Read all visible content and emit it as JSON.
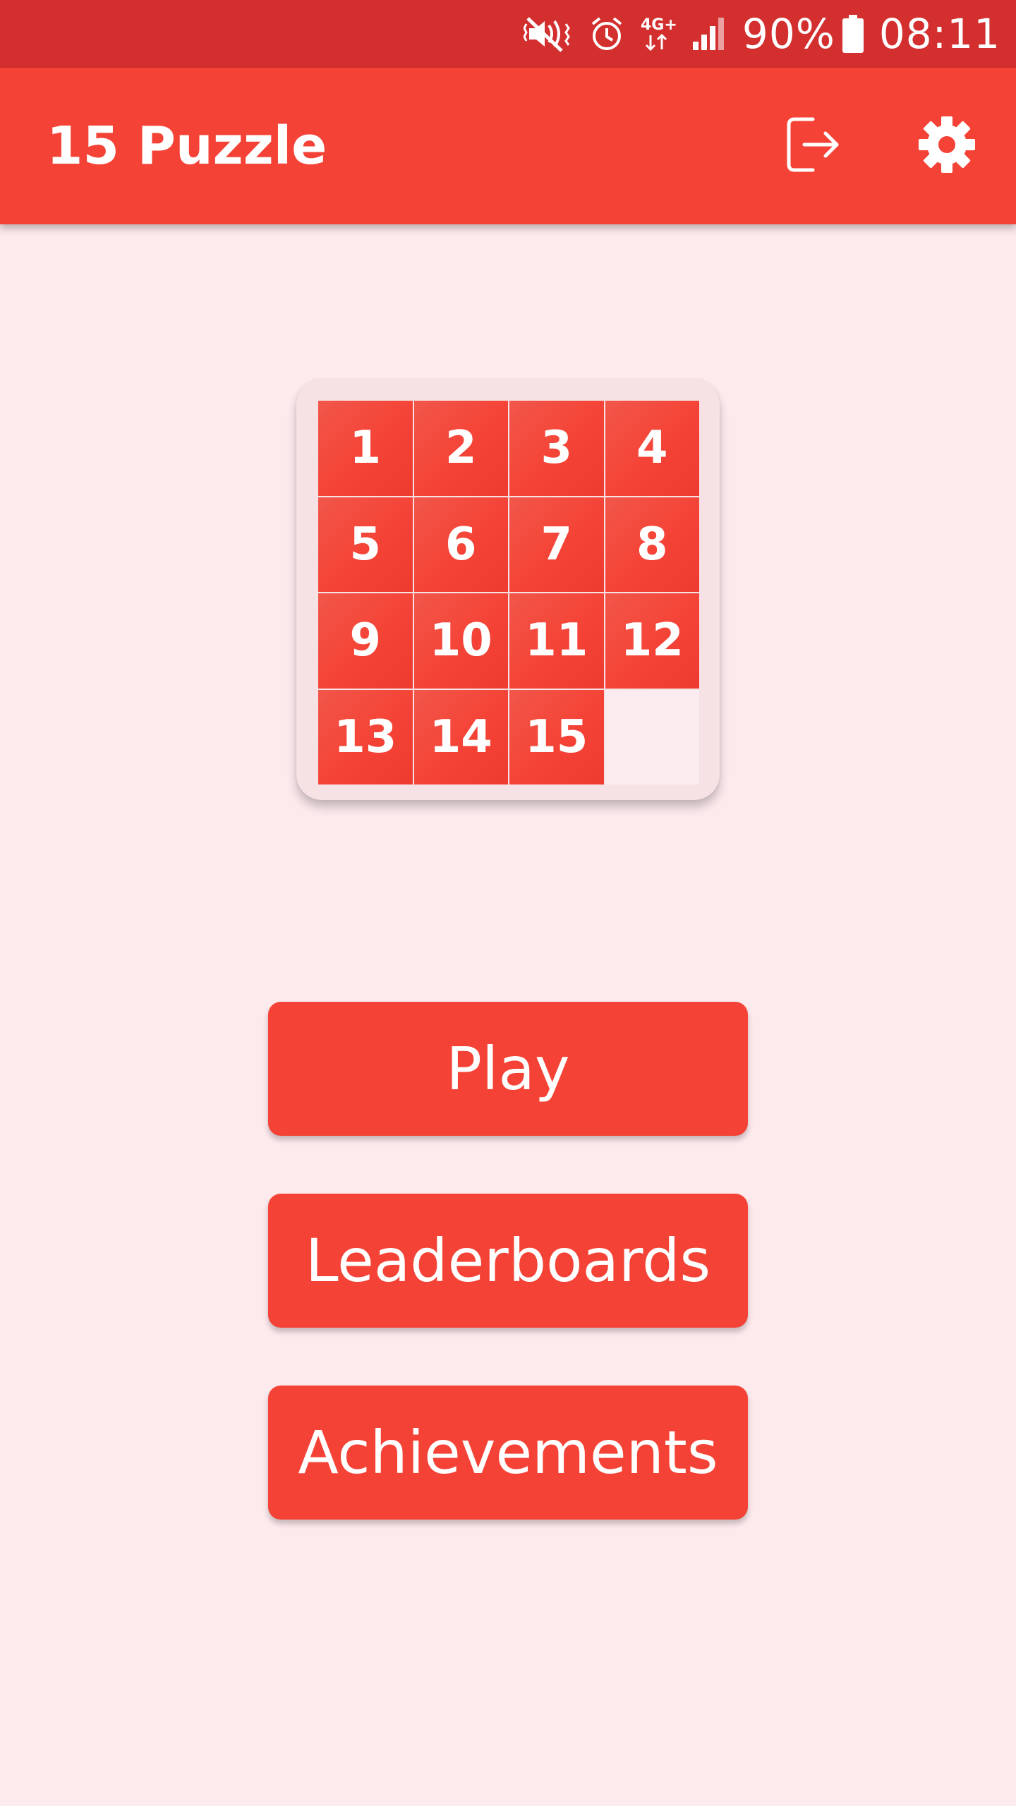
{
  "status_bar": {
    "battery_percent": "90%",
    "time": "08:11",
    "network_label": "4G+",
    "icons": [
      "mute-icon",
      "alarm-icon",
      "network-4g-icon",
      "signal-icon",
      "battery-icon"
    ]
  },
  "app_bar": {
    "title": "15 Puzzle",
    "actions": [
      "logout-icon",
      "gear-icon"
    ]
  },
  "board": {
    "tiles": [
      "1",
      "2",
      "3",
      "4",
      "5",
      "6",
      "7",
      "8",
      "9",
      "10",
      "11",
      "12",
      "13",
      "14",
      "15",
      ""
    ]
  },
  "menu": {
    "play_label": "Play",
    "leaderboards_label": "Leaderboards",
    "achievements_label": "Achievements"
  },
  "colors": {
    "status_bar": "#d32f2f",
    "primary": "#f44336",
    "background": "#fdeaed",
    "board_frame": "#f6e1e5"
  }
}
